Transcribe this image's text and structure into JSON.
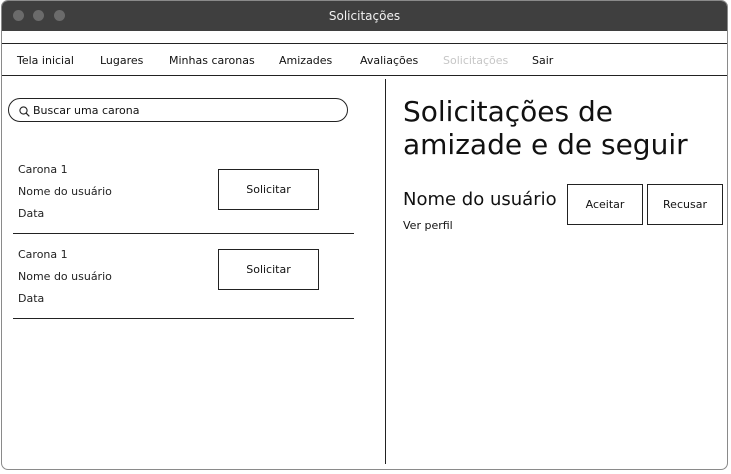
{
  "window": {
    "title": "Solicitações"
  },
  "nav": {
    "items": [
      {
        "label": "Tela inicial"
      },
      {
        "label": "Lugares"
      },
      {
        "label": "Minhas caronas"
      },
      {
        "label": "Amizades"
      },
      {
        "label": "Avaliações"
      },
      {
        "label": "Solicitações",
        "disabled": true
      },
      {
        "label": "Sair"
      }
    ]
  },
  "search": {
    "placeholder": "Buscar uma carona"
  },
  "rides": [
    {
      "title": "Carona 1",
      "user": "Nome do usuário",
      "date": "Data",
      "button": "Solicitar"
    },
    {
      "title": "Carona 1",
      "user": "Nome do usuário",
      "date": "Data",
      "button": "Solicitar"
    }
  ],
  "requests": {
    "heading": "Solicitações de amizade e de seguir",
    "user_name": "Nome do usuário",
    "profile_link": "Ver perfil",
    "accept_label": "Aceitar",
    "reject_label": "Recusar"
  },
  "colors": {
    "titlebar": "#3f3f3f",
    "disabled_text": "#c6c6c6"
  }
}
